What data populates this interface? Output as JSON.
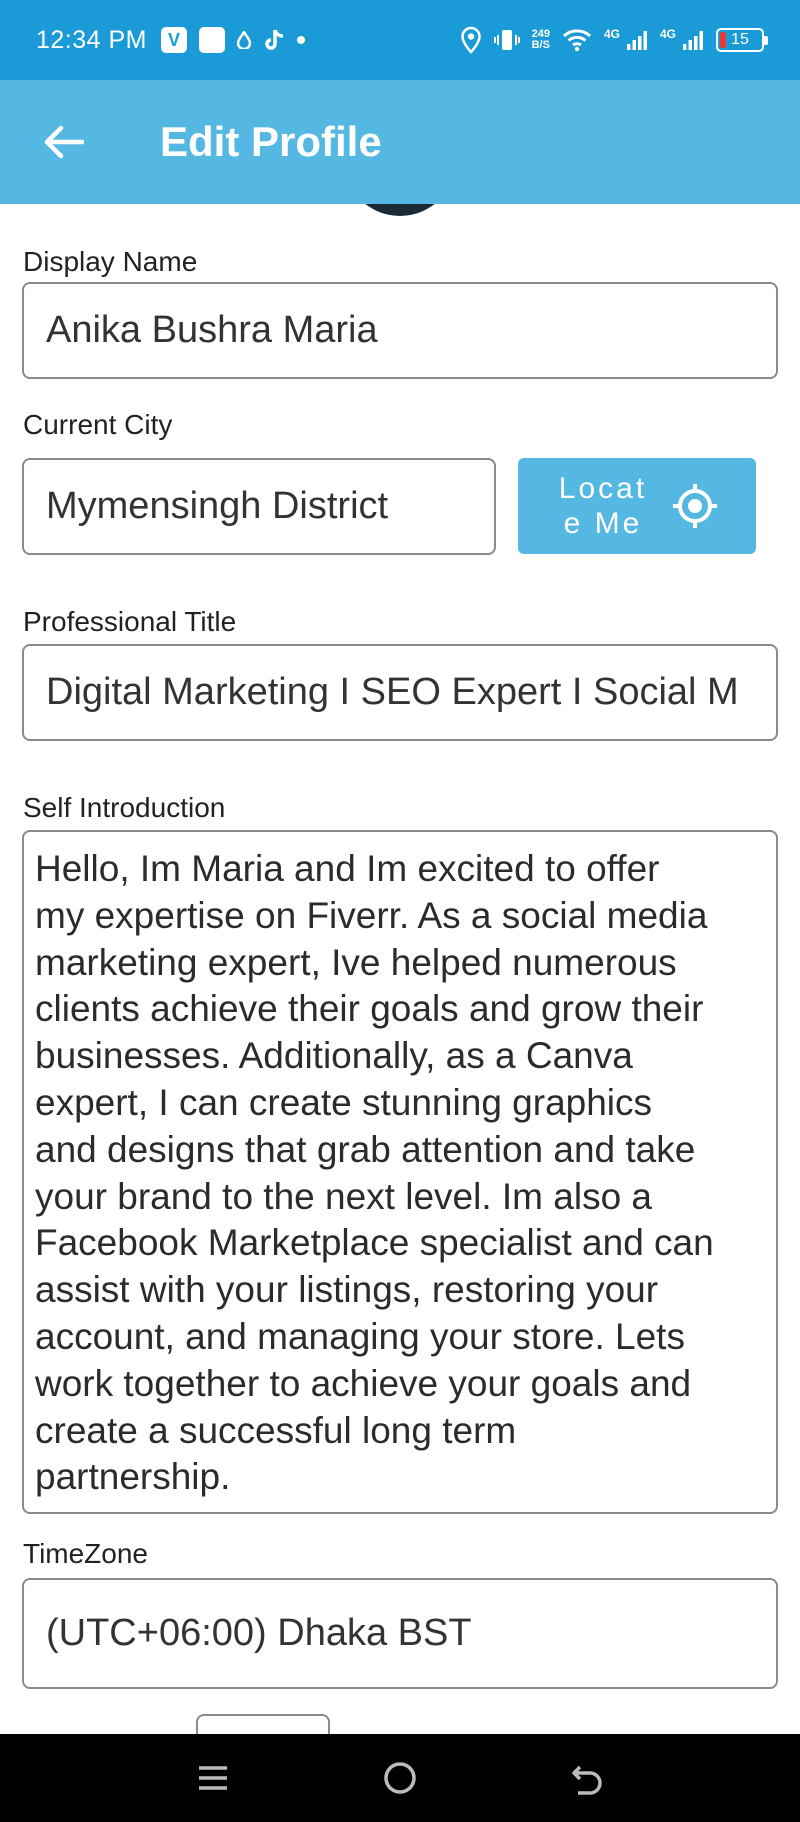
{
  "status_bar": {
    "time": "12:34 PM",
    "left_icons": [
      "v-app-icon",
      "square-app-icon",
      "drop-icon",
      "tiktok-icon",
      "dot-icon"
    ],
    "net_speed_value": "249",
    "net_speed_unit": "B/S",
    "network_type_1": "4G",
    "network_type_2": "4G",
    "battery_level": "15",
    "battery_color": "#e53935"
  },
  "app_bar": {
    "title": "Edit Profile",
    "back_icon": "arrow-left-icon",
    "color": "#55b8e2"
  },
  "form": {
    "display_name": {
      "label": "Display Name",
      "value": "Anika Bushra Maria"
    },
    "current_city": {
      "label": "Current City",
      "value": "Mymensingh District",
      "locate_button": "Locate Me",
      "locate_icon": "crosshair-icon"
    },
    "professional_title": {
      "label": "Professional Title",
      "value": "Digital Marketing I SEO Expert I Social M"
    },
    "self_introduction": {
      "label": "Self Introduction",
      "lines": [
        "Hello, Im Maria and Im excited to offer",
        "my expertise on Fiverr. As a social media",
        "marketing expert, Ive helped numerous",
        "clients achieve their goals and grow their",
        "businesses. Additionally, as a Canva",
        "expert, I can create stunning graphics",
        "and designs that grab attention and take",
        "your brand to the next level. Im also a",
        "Facebook Marketplace specialist and can",
        "assist with your listings, restoring your",
        "account, and managing your store. Lets",
        "work together to achieve your goals and",
        "create a successful long term",
        "partnership."
      ]
    },
    "timezone": {
      "label": "TimeZone",
      "value": "(UTC+06:00) Dhaka BST"
    }
  },
  "nav_bar": {
    "icons": [
      "menu-icon",
      "home-icon",
      "back-icon"
    ]
  }
}
